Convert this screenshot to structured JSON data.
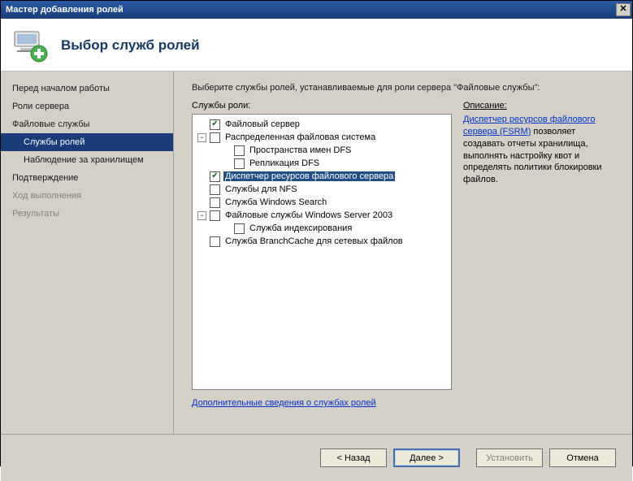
{
  "window": {
    "title": "Мастер добавления ролей"
  },
  "header": {
    "title": "Выбор служб ролей"
  },
  "sidebar": {
    "items": [
      {
        "label": "Перед началом работы",
        "sub": false
      },
      {
        "label": "Роли сервера",
        "sub": false
      },
      {
        "label": "Файловые службы",
        "sub": false
      },
      {
        "label": "Службы ролей",
        "sub": true,
        "selected": true
      },
      {
        "label": "Наблюдение за хранилищем",
        "sub": true
      },
      {
        "label": "Подтверждение",
        "sub": false
      },
      {
        "label": "Ход выполнения",
        "sub": false,
        "disabled": true
      },
      {
        "label": "Результаты",
        "sub": false,
        "disabled": true
      }
    ]
  },
  "content": {
    "intro": "Выберите службы ролей, устанавливаемые для роли сервера \"Файловые службы\":",
    "tree_label": "Службы роли:",
    "desc_label": "Описание:",
    "more_info": "Дополнительные сведения о службах ролей",
    "desc_link": "Диспетчер ресурсов файлового сервера (FSRM)",
    "desc_rest": " позволяет создавать отчеты хранилища, выполнять настройку квот и определять политики блокировки файлов.",
    "tree": [
      {
        "indent": 0,
        "toggle": null,
        "checked": true,
        "label": "Файловый сервер"
      },
      {
        "indent": 0,
        "toggle": "-",
        "checked": false,
        "label": "Распределенная файловая система"
      },
      {
        "indent": 1,
        "toggle": null,
        "checked": false,
        "label": "Пространства имен DFS"
      },
      {
        "indent": 1,
        "toggle": null,
        "checked": false,
        "label": "Репликация DFS"
      },
      {
        "indent": 0,
        "toggle": null,
        "checked": true,
        "label": "Диспетчер ресурсов файлового сервера",
        "hl": true
      },
      {
        "indent": 0,
        "toggle": null,
        "checked": false,
        "label": "Службы для NFS"
      },
      {
        "indent": 0,
        "toggle": null,
        "checked": false,
        "label": "Служба Windows Search"
      },
      {
        "indent": 0,
        "toggle": "-",
        "checked": false,
        "label": "Файловые службы Windows Server 2003"
      },
      {
        "indent": 1,
        "toggle": null,
        "checked": false,
        "label": "Служба индексирования"
      },
      {
        "indent": 0,
        "toggle": null,
        "checked": false,
        "label": "Служба BranchCache для сетевых файлов"
      }
    ]
  },
  "buttons": {
    "back": "< Назад",
    "next": "Далее >",
    "install": "Установить",
    "cancel": "Отмена"
  }
}
